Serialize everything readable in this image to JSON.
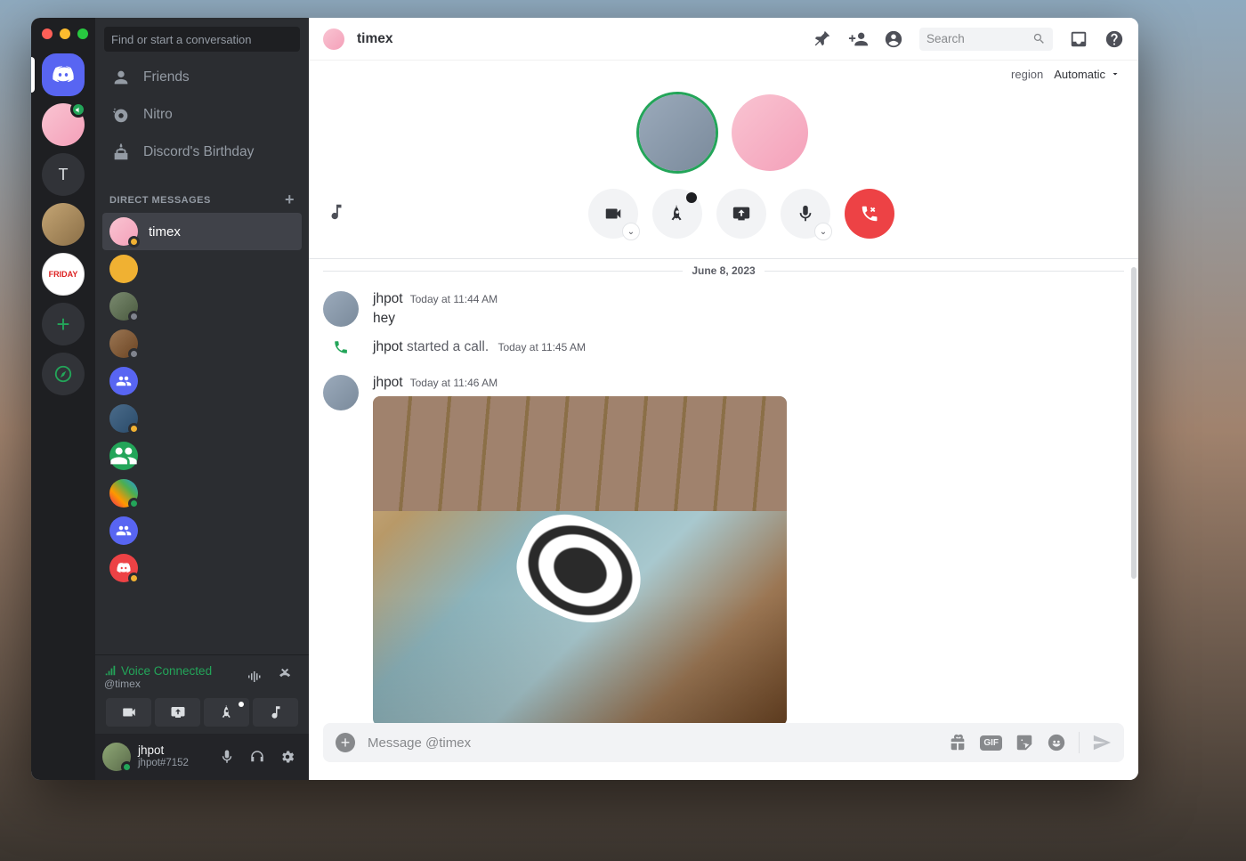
{
  "window": {
    "title": "timex"
  },
  "sidebar": {
    "search_placeholder": "Find or start a conversation",
    "nav": {
      "friends": "Friends",
      "nitro": "Nitro",
      "birthday": "Discord's Birthday"
    },
    "dm_header": "DIRECT MESSAGES",
    "dms": [
      {
        "name": "timex"
      }
    ],
    "voice": {
      "status": "Voice Connected",
      "channel": "@timex"
    },
    "user": {
      "name": "jhpot",
      "tag": "jhpot#7152"
    }
  },
  "servers": {
    "letter": "T",
    "friday": "FRIDAY"
  },
  "main": {
    "search_placeholder": "Search",
    "region_label": "region",
    "region_value": "Automatic",
    "date_divider": "June 8, 2023",
    "messages": [
      {
        "author": "jhpot",
        "time": "Today at 11:44 AM",
        "text": "hey"
      },
      {
        "author": "jhpot",
        "system_text": "started a call.",
        "time": "Today at 11:45 AM"
      },
      {
        "author": "jhpot",
        "time": "Today at 11:46 AM"
      }
    ],
    "composer_placeholder": "Message @timex"
  }
}
